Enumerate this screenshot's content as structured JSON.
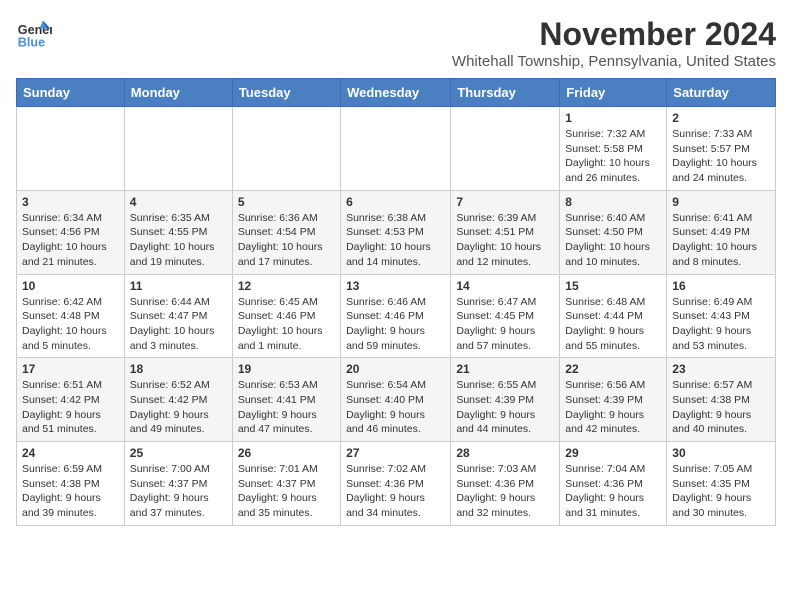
{
  "logo": {
    "line1": "General",
    "line2": "Blue"
  },
  "title": "November 2024",
  "location": "Whitehall Township, Pennsylvania, United States",
  "days_of_week": [
    "Sunday",
    "Monday",
    "Tuesday",
    "Wednesday",
    "Thursday",
    "Friday",
    "Saturday"
  ],
  "weeks": [
    [
      {
        "day": null,
        "info": null
      },
      {
        "day": null,
        "info": null
      },
      {
        "day": null,
        "info": null
      },
      {
        "day": null,
        "info": null
      },
      {
        "day": null,
        "info": null
      },
      {
        "day": "1",
        "info": "Sunrise: 7:32 AM\nSunset: 5:58 PM\nDaylight: 10 hours\nand 26 minutes."
      },
      {
        "day": "2",
        "info": "Sunrise: 7:33 AM\nSunset: 5:57 PM\nDaylight: 10 hours\nand 24 minutes."
      }
    ],
    [
      {
        "day": "3",
        "info": "Sunrise: 6:34 AM\nSunset: 4:56 PM\nDaylight: 10 hours\nand 21 minutes."
      },
      {
        "day": "4",
        "info": "Sunrise: 6:35 AM\nSunset: 4:55 PM\nDaylight: 10 hours\nand 19 minutes."
      },
      {
        "day": "5",
        "info": "Sunrise: 6:36 AM\nSunset: 4:54 PM\nDaylight: 10 hours\nand 17 minutes."
      },
      {
        "day": "6",
        "info": "Sunrise: 6:38 AM\nSunset: 4:53 PM\nDaylight: 10 hours\nand 14 minutes."
      },
      {
        "day": "7",
        "info": "Sunrise: 6:39 AM\nSunset: 4:51 PM\nDaylight: 10 hours\nand 12 minutes."
      },
      {
        "day": "8",
        "info": "Sunrise: 6:40 AM\nSunset: 4:50 PM\nDaylight: 10 hours\nand 10 minutes."
      },
      {
        "day": "9",
        "info": "Sunrise: 6:41 AM\nSunset: 4:49 PM\nDaylight: 10 hours\nand 8 minutes."
      }
    ],
    [
      {
        "day": "10",
        "info": "Sunrise: 6:42 AM\nSunset: 4:48 PM\nDaylight: 10 hours\nand 5 minutes."
      },
      {
        "day": "11",
        "info": "Sunrise: 6:44 AM\nSunset: 4:47 PM\nDaylight: 10 hours\nand 3 minutes."
      },
      {
        "day": "12",
        "info": "Sunrise: 6:45 AM\nSunset: 4:46 PM\nDaylight: 10 hours\nand 1 minute."
      },
      {
        "day": "13",
        "info": "Sunrise: 6:46 AM\nSunset: 4:46 PM\nDaylight: 9 hours\nand 59 minutes."
      },
      {
        "day": "14",
        "info": "Sunrise: 6:47 AM\nSunset: 4:45 PM\nDaylight: 9 hours\nand 57 minutes."
      },
      {
        "day": "15",
        "info": "Sunrise: 6:48 AM\nSunset: 4:44 PM\nDaylight: 9 hours\nand 55 minutes."
      },
      {
        "day": "16",
        "info": "Sunrise: 6:49 AM\nSunset: 4:43 PM\nDaylight: 9 hours\nand 53 minutes."
      }
    ],
    [
      {
        "day": "17",
        "info": "Sunrise: 6:51 AM\nSunset: 4:42 PM\nDaylight: 9 hours\nand 51 minutes."
      },
      {
        "day": "18",
        "info": "Sunrise: 6:52 AM\nSunset: 4:42 PM\nDaylight: 9 hours\nand 49 minutes."
      },
      {
        "day": "19",
        "info": "Sunrise: 6:53 AM\nSunset: 4:41 PM\nDaylight: 9 hours\nand 47 minutes."
      },
      {
        "day": "20",
        "info": "Sunrise: 6:54 AM\nSunset: 4:40 PM\nDaylight: 9 hours\nand 46 minutes."
      },
      {
        "day": "21",
        "info": "Sunrise: 6:55 AM\nSunset: 4:39 PM\nDaylight: 9 hours\nand 44 minutes."
      },
      {
        "day": "22",
        "info": "Sunrise: 6:56 AM\nSunset: 4:39 PM\nDaylight: 9 hours\nand 42 minutes."
      },
      {
        "day": "23",
        "info": "Sunrise: 6:57 AM\nSunset: 4:38 PM\nDaylight: 9 hours\nand 40 minutes."
      }
    ],
    [
      {
        "day": "24",
        "info": "Sunrise: 6:59 AM\nSunset: 4:38 PM\nDaylight: 9 hours\nand 39 minutes."
      },
      {
        "day": "25",
        "info": "Sunrise: 7:00 AM\nSunset: 4:37 PM\nDaylight: 9 hours\nand 37 minutes."
      },
      {
        "day": "26",
        "info": "Sunrise: 7:01 AM\nSunset: 4:37 PM\nDaylight: 9 hours\nand 35 minutes."
      },
      {
        "day": "27",
        "info": "Sunrise: 7:02 AM\nSunset: 4:36 PM\nDaylight: 9 hours\nand 34 minutes."
      },
      {
        "day": "28",
        "info": "Sunrise: 7:03 AM\nSunset: 4:36 PM\nDaylight: 9 hours\nand 32 minutes."
      },
      {
        "day": "29",
        "info": "Sunrise: 7:04 AM\nSunset: 4:36 PM\nDaylight: 9 hours\nand 31 minutes."
      },
      {
        "day": "30",
        "info": "Sunrise: 7:05 AM\nSunset: 4:35 PM\nDaylight: 9 hours\nand 30 minutes."
      }
    ]
  ]
}
